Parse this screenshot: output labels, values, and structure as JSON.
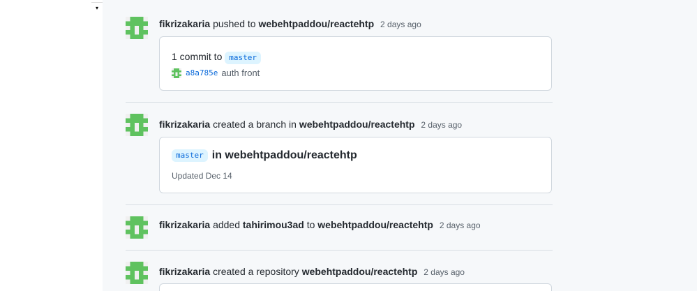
{
  "scrollbar": {
    "down_arrow": "▾"
  },
  "events": [
    {
      "user": "fikrizakaria",
      "action": "pushed to",
      "repo": "webehtpaddou/reactehtp",
      "time": "2 days ago",
      "card": {
        "commit_count_text": "1 commit to",
        "branch": "master",
        "commit_sha": "a8a785e",
        "commit_message": "auth front"
      }
    },
    {
      "user": "fikrizakaria",
      "action": "created a branch in",
      "repo": "webehtpaddou/reactehtp",
      "time": "2 days ago",
      "card": {
        "branch": "master",
        "in_repo": "in webehtpaddou/reactehtp",
        "updated": "Updated Dec 14"
      }
    },
    {
      "user": "fikrizakaria",
      "action": "added",
      "target": "tahirimou3ad",
      "connector": "to",
      "repo": "webehtpaddou/reactehtp",
      "time": "2 days ago"
    },
    {
      "user": "fikrizakaria",
      "action": "created a repository",
      "repo": "webehtpaddou/reactehtp",
      "time": "2 days ago"
    }
  ],
  "colors": {
    "avatar_green": "#5fc25f",
    "link_blue": "#0969da",
    "tag_bg": "#ddf4ff"
  },
  "icons": {
    "avatar": "identicon-avatar"
  }
}
